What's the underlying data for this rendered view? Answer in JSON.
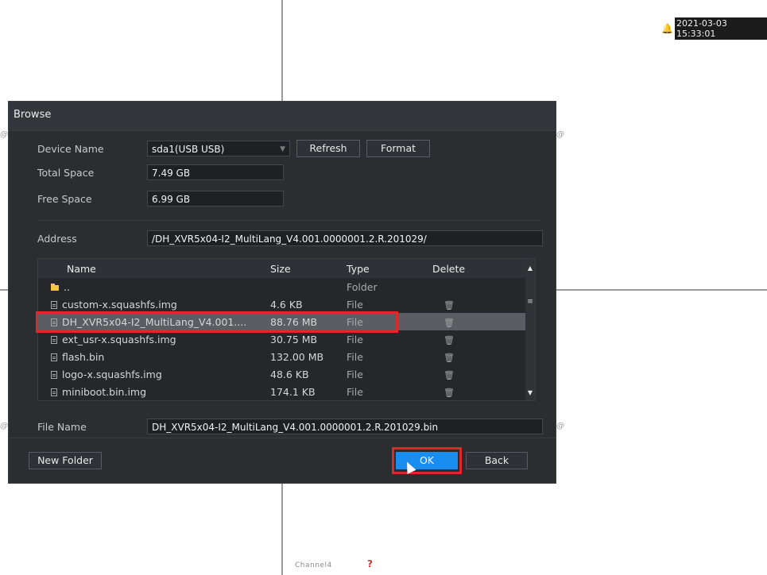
{
  "overlay": {
    "datetime": "2021-03-03 15:33:01",
    "channel_label": "Channel4",
    "question_mark": "?"
  },
  "dialog": {
    "title": "Browse",
    "device_name_label": "Device Name",
    "device_name_value": "sda1(USB USB)",
    "refresh_label": "Refresh",
    "format_label": "Format",
    "total_space_label": "Total Space",
    "total_space_value": "7.49 GB",
    "free_space_label": "Free Space",
    "free_space_value": "6.99 GB",
    "address_label": "Address",
    "address_value": "/DH_XVR5x04-I2_MultiLang_V4.001.0000001.2.R.201029/",
    "table": {
      "headers": {
        "name": "Name",
        "size": "Size",
        "type": "Type",
        "delete": "Delete"
      },
      "rows": [
        {
          "name": "..",
          "size": "",
          "type": "Folder",
          "icon": "folder-icon",
          "deletable": false
        },
        {
          "name": "custom-x.squashfs.img",
          "size": "4.6 KB",
          "type": "File",
          "icon": "file-icon",
          "deletable": true
        },
        {
          "name": "DH_XVR5x04-I2_MultiLang_V4.001....",
          "size": "88.76 MB",
          "type": "File",
          "icon": "file-icon",
          "deletable": true,
          "selected": true
        },
        {
          "name": "ext_usr-x.squashfs.img",
          "size": "30.75 MB",
          "type": "File",
          "icon": "file-icon",
          "deletable": true
        },
        {
          "name": "flash.bin",
          "size": "132.00 MB",
          "type": "File",
          "icon": "file-icon",
          "deletable": true
        },
        {
          "name": "logo-x.squashfs.img",
          "size": "48.6 KB",
          "type": "File",
          "icon": "file-icon",
          "deletable": true
        },
        {
          "name": "miniboot.bin.img",
          "size": "174.1 KB",
          "type": "File",
          "icon": "file-icon",
          "deletable": true
        }
      ]
    },
    "file_name_label": "File Name",
    "file_name_value": "DH_XVR5x04-I2_MultiLang_V4.001.0000001.2.R.201029.bin",
    "new_folder_label": "New Folder",
    "ok_label": "OK",
    "back_label": "Back"
  },
  "colors": {
    "accent": "#1a8ef0",
    "highlight": "#e0282a",
    "dialog_bg": "#2b2d31"
  }
}
